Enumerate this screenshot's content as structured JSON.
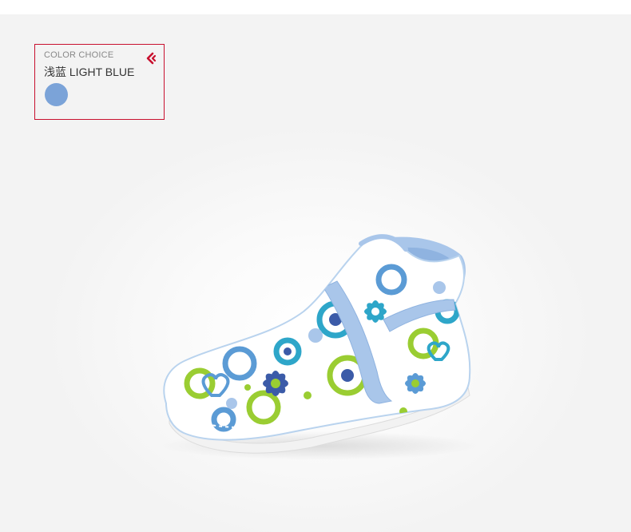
{
  "color_choice": {
    "heading": "COLOR CHOICE",
    "color_name": "浅蓝 LIGHT BLUE",
    "swatch_color": "#7ba3d8",
    "accent_color": "#c8102e",
    "icon": "back-arrow-icon"
  },
  "product_image": {
    "subject": "floral-print-slipper-boot",
    "lining_color": "#a9c6ea",
    "print_colors": [
      "#5b9bd5",
      "#2ea6c9",
      "#9acd32",
      "#3b5ba8",
      "#ffffff"
    ]
  }
}
